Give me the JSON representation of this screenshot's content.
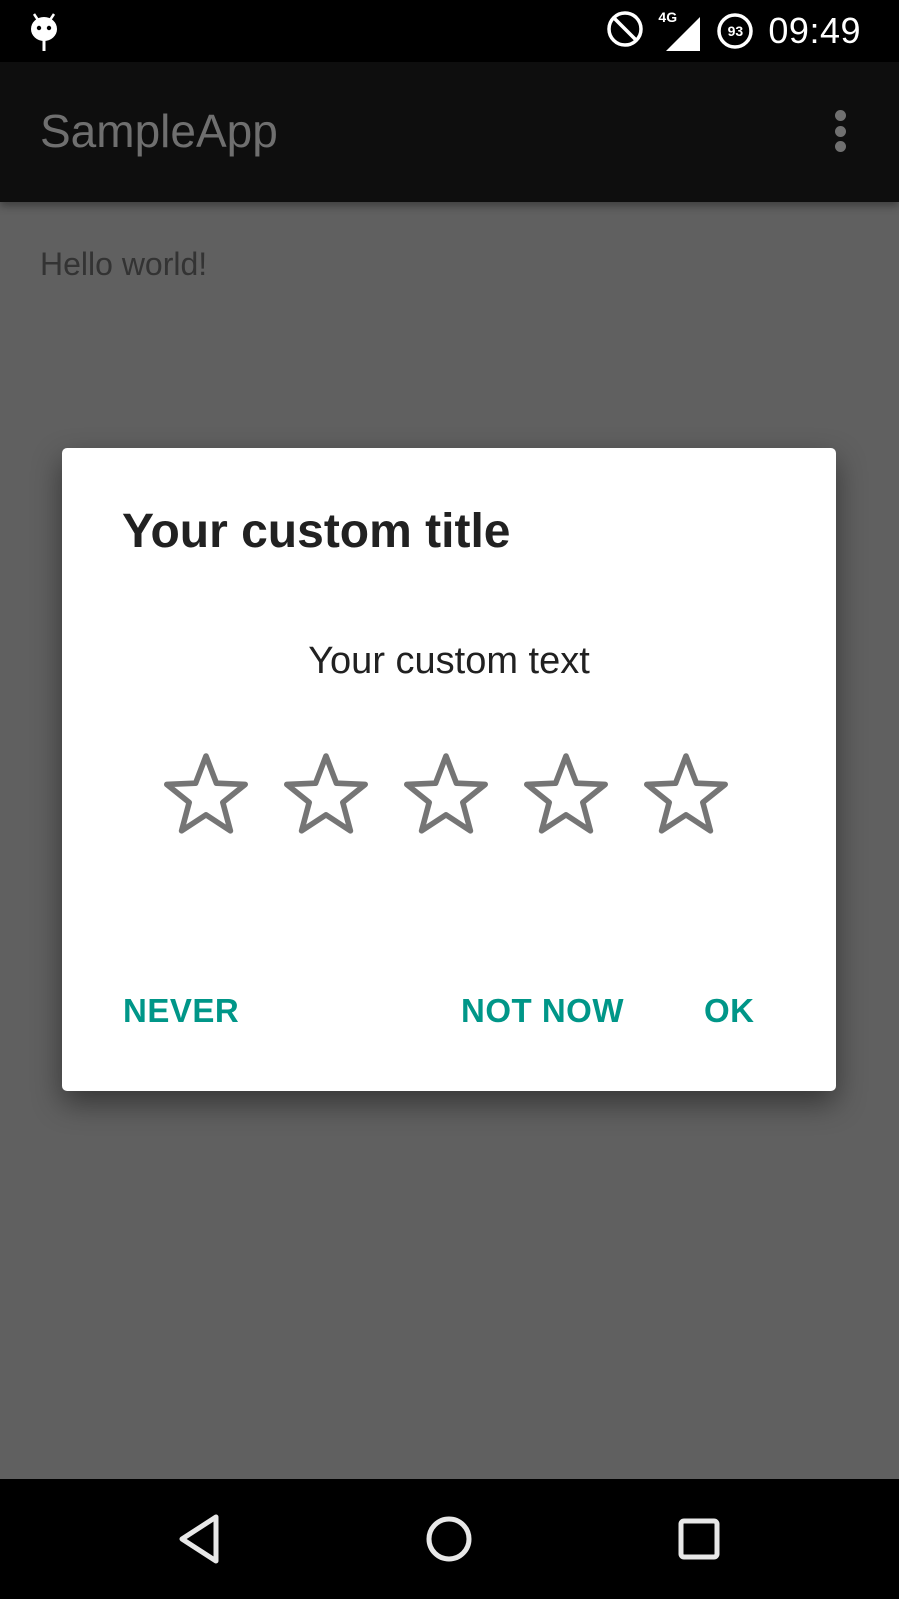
{
  "status_bar": {
    "notification_icon": "android-debug-icon",
    "dnd_icon": "do-not-disturb-icon",
    "network_type": "4G",
    "signal_icon": "cell-signal-icon",
    "battery_level": "93",
    "time": "09:49"
  },
  "app_bar": {
    "title": "SampleApp",
    "menu_icon": "overflow-menu-icon"
  },
  "content": {
    "text": "Hello world!"
  },
  "dialog": {
    "title": "Your custom title",
    "text": "Your custom text",
    "rating": {
      "value": 0,
      "max": 5
    },
    "buttons": {
      "never": "NEVER",
      "not_now": "NOT NOW",
      "ok": "OK"
    },
    "accent_color": "#009688"
  },
  "nav_bar": {
    "back": "back-icon",
    "home": "home-icon",
    "recents": "recents-icon"
  }
}
